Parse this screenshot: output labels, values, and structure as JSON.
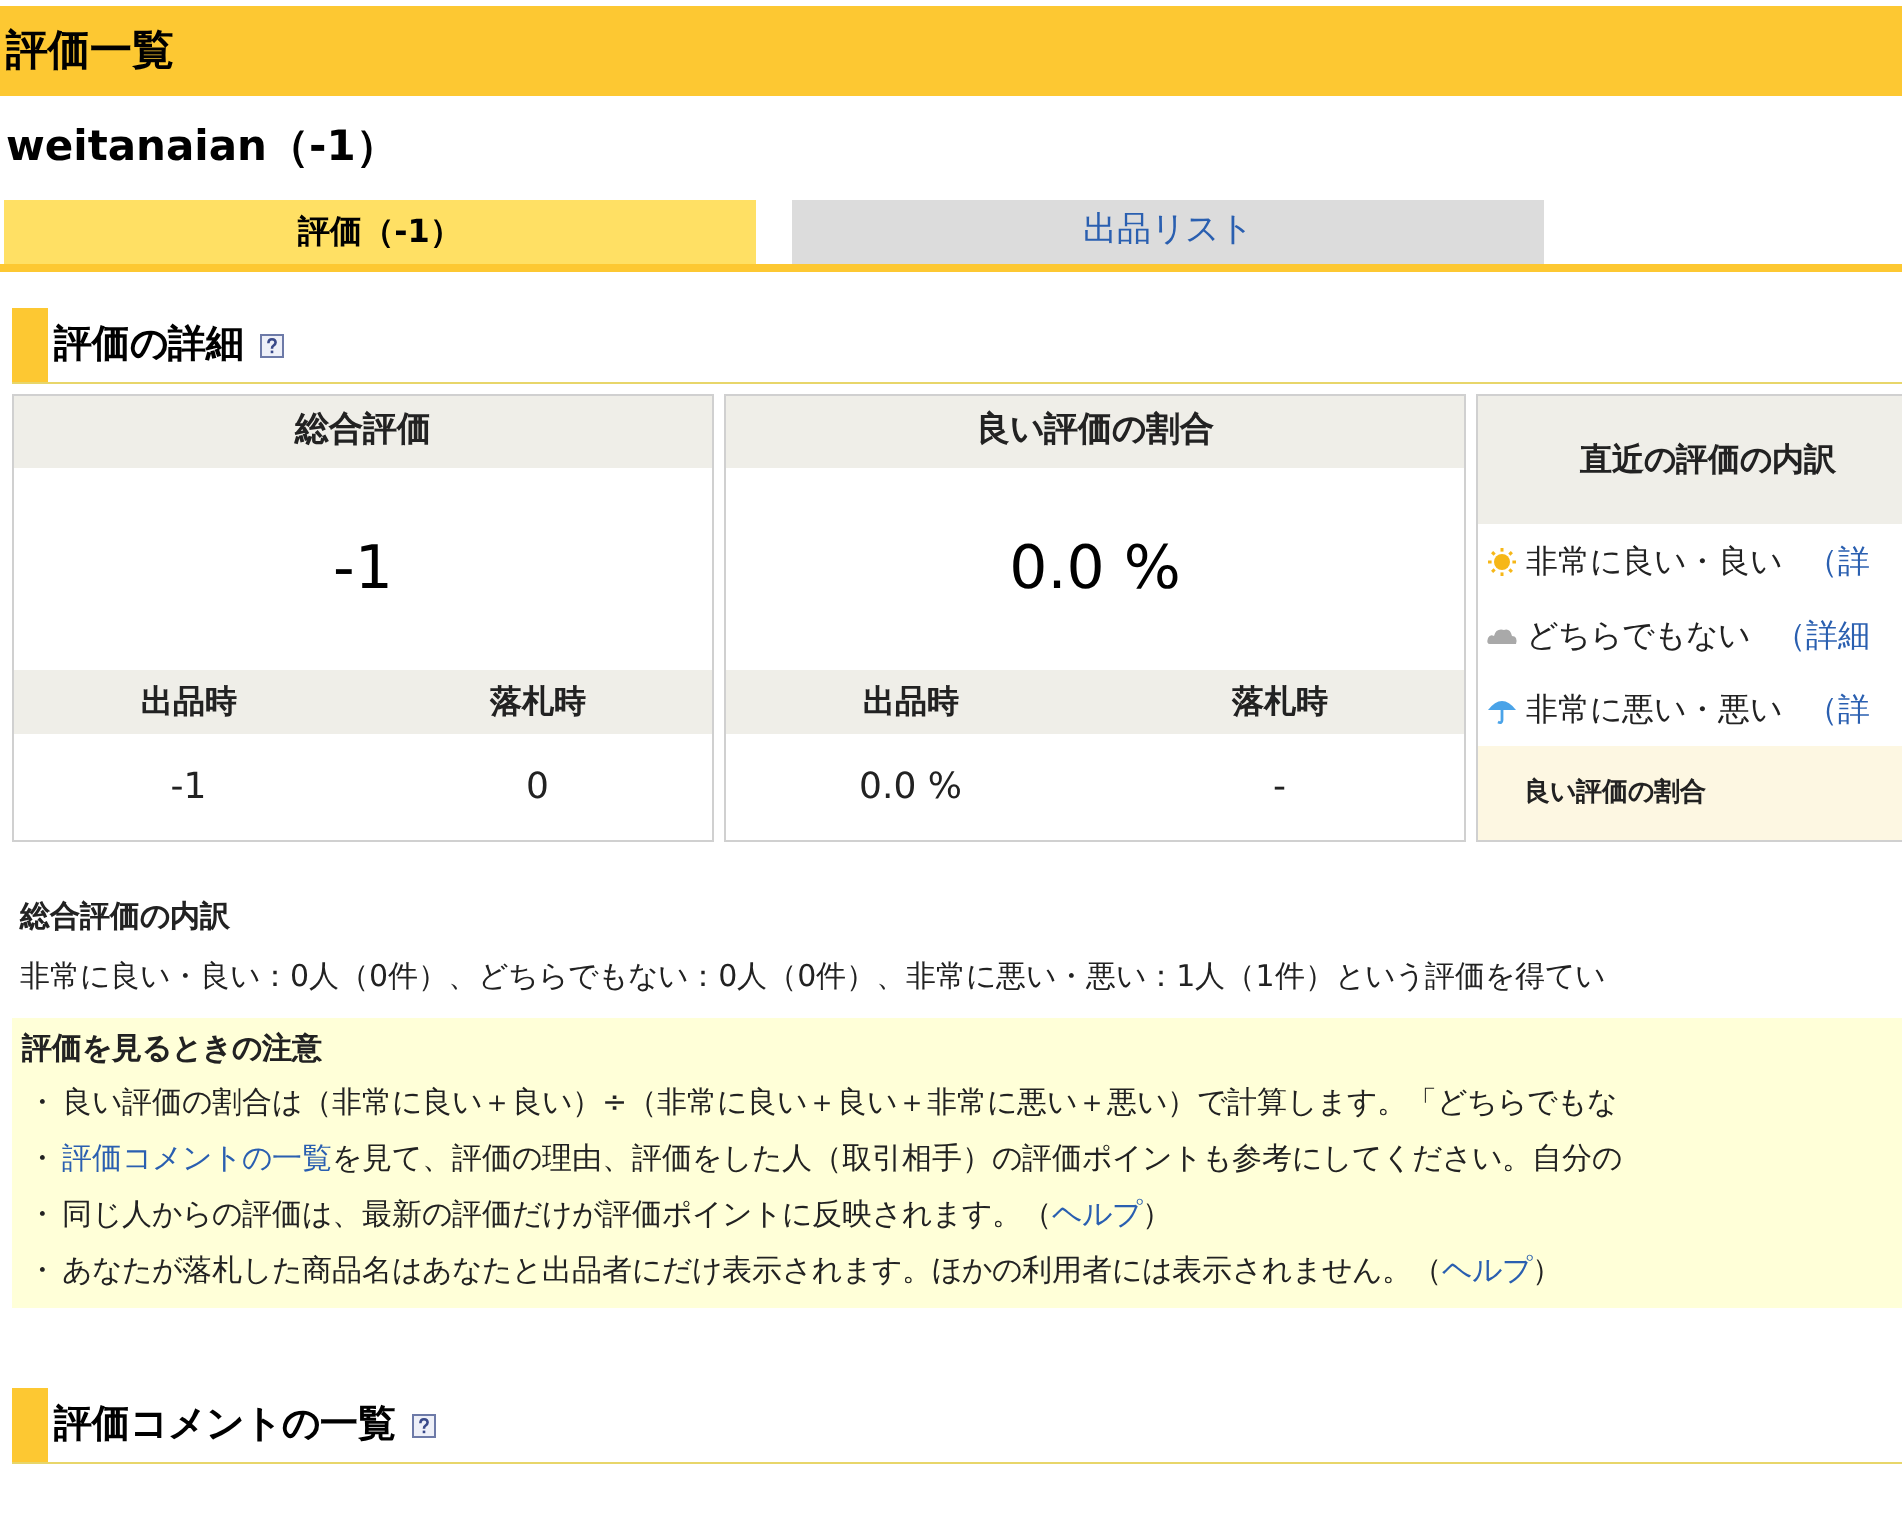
{
  "page_title": "評価一覧",
  "user_heading": "weitanaian（-1）",
  "tabs": [
    {
      "label": "評価（-1）",
      "selected": true
    },
    {
      "label": "出品リスト",
      "selected": false
    }
  ],
  "detail_section": {
    "title": "評価の詳細",
    "cards": [
      {
        "title": "総合評価",
        "value": "-1",
        "sub_columns": [
          "出品時",
          "落札時"
        ],
        "sub_values": [
          "-1",
          "0"
        ]
      },
      {
        "title": "良い評価の割合",
        "value": "0.0 %",
        "sub_columns": [
          "出品時",
          "落札時"
        ],
        "sub_values": [
          "0.0 %",
          "-"
        ]
      }
    ],
    "recent": {
      "title": "直近の評価の内訳",
      "rows": [
        {
          "kind": "sunny",
          "label": "非常に良い・良い",
          "link": "（詳"
        },
        {
          "kind": "cloudy",
          "label": "どちらでもない",
          "link": "（詳細"
        },
        {
          "kind": "rainy",
          "label": "非常に悪い・悪い",
          "link": "（詳"
        }
      ],
      "footer": "良い評価の割合"
    }
  },
  "breakdown": {
    "title": "総合評価の内訳",
    "text": "非常に良い・良い：0人（0件）、どちらでもない：0人（0件）、非常に悪い・悪い：1人（1件）という評価を得てい"
  },
  "notes": {
    "title": "評価を見るときの注意",
    "items": [
      {
        "bullet": "・",
        "parts": [
          {
            "text": "良い評価の割合は（非常に良い＋良い）÷（非常に良い＋良い＋非常に悪い＋悪い）で計算します。「どちらでもな",
            "link": false
          }
        ]
      },
      {
        "bullet": "・",
        "parts": [
          {
            "text": "評価コメントの一覧",
            "link": true
          },
          {
            "text": "を見て、評価の理由、評価をした人（取引相手）の評価ポイントも参考にしてください。自分の",
            "link": false
          }
        ]
      },
      {
        "bullet": "・",
        "parts": [
          {
            "text": "同じ人からの評価は、最新の評価だけが評価ポイントに反映されます。（",
            "link": false
          },
          {
            "text": "ヘルプ",
            "link": true
          },
          {
            "text": "）",
            "link": false
          }
        ]
      },
      {
        "bullet": "・",
        "parts": [
          {
            "text": "あなたが落札した商品名はあなたと出品者にだけ表示されます。ほかの利用者には表示されません。（",
            "link": false
          },
          {
            "text": "ヘルプ",
            "link": true
          },
          {
            "text": "）",
            "link": false
          }
        ]
      }
    ]
  },
  "comments_section": {
    "title": "評価コメントの一覧"
  }
}
